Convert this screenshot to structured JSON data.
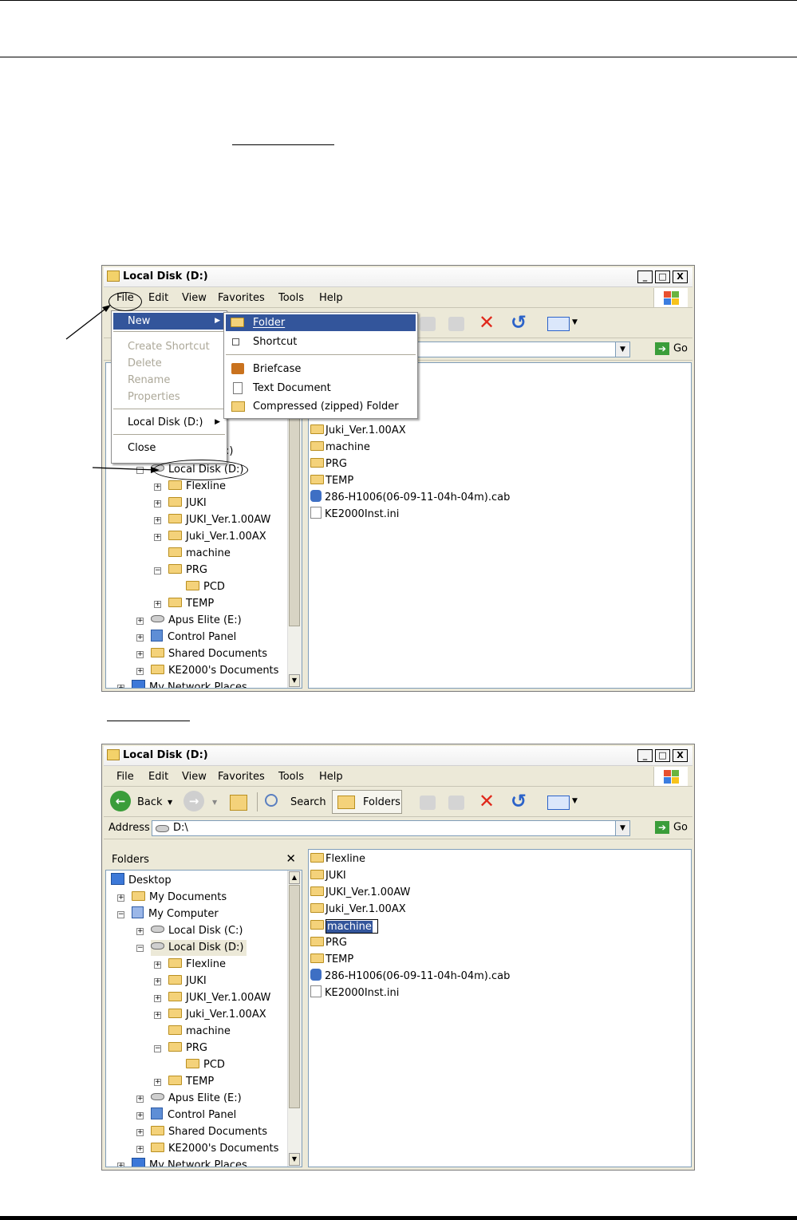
{
  "window1": {
    "title": "Local Disk (D:)",
    "menu": [
      "File",
      "Edit",
      "View",
      "Favorites",
      "Tools",
      "Help"
    ],
    "controls": [
      "_",
      "□",
      "X"
    ],
    "go_label": "Go",
    "file_menu": {
      "new": "New",
      "create_shortcut": "Create Shortcut",
      "delete": "Delete",
      "rename": "Rename",
      "properties": "Properties",
      "local_disk": "Local Disk (D:)",
      "close": "Close"
    },
    "new_submenu": {
      "folder": "Folder",
      "shortcut": "Shortcut",
      "briefcase": "Briefcase",
      "text_document": "Text Document",
      "compressed_folder": "Compressed (zipped) Folder"
    },
    "tree": {
      "partial_c": ":)",
      "local_d": "Local Disk (D:)",
      "flexline": "Flexline",
      "juki": "JUKI",
      "juki_aw": "JUKI_Ver.1.00AW",
      "juki_ax": "Juki_Ver.1.00AX",
      "machine": "machine",
      "prg": "PRG",
      "pcd": "PCD",
      "temp": "TEMP",
      "apus": "Apus Elite (E:)",
      "control_panel": "Control Panel",
      "shared_docs": "Shared Documents",
      "ke2000_docs": "KE2000's Documents",
      "network": "My Network Places"
    },
    "files": {
      "juki_ax": "Juki_Ver.1.00AX",
      "machine": "machine",
      "prg": "PRG",
      "temp": "TEMP",
      "cab": "286-H1006(06-09-11-04h-04m).cab",
      "ini": "KE2000Inst.ini"
    }
  },
  "window2": {
    "title": "Local Disk (D:)",
    "menu": [
      "File",
      "Edit",
      "View",
      "Favorites",
      "Tools",
      "Help"
    ],
    "controls": [
      "_",
      "□",
      "X"
    ],
    "toolbar": {
      "back": "Back",
      "search": "Search",
      "folders": "Folders"
    },
    "address_label": "Address",
    "address_value": "D:\\",
    "go_label": "Go",
    "folders_pane_title": "Folders",
    "tree": {
      "desktop": "Desktop",
      "my_documents": "My Documents",
      "my_computer": "My Computer",
      "local_c": "Local Disk (C:)",
      "local_d": "Local Disk (D:)",
      "flexline": "Flexline",
      "juki": "JUKI",
      "juki_aw": "JUKI_Ver.1.00AW",
      "juki_ax": "Juki_Ver.1.00AX",
      "machine": "machine",
      "prg": "PRG",
      "pcd": "PCD",
      "temp": "TEMP",
      "apus": "Apus Elite (E:)",
      "control_panel": "Control Panel",
      "shared_docs": "Shared Documents",
      "ke2000_docs": "KE2000's Documents",
      "network": "My Network Places"
    },
    "files": {
      "flexline": "Flexline",
      "juki": "JUKI",
      "juki_aw": "JUKI_Ver.1.00AW",
      "juki_ax": "Juki_Ver.1.00AX",
      "machine": "machine",
      "prg": "PRG",
      "temp": "TEMP",
      "cab": "286-H1006(06-09-11-04h-04m).cab",
      "ini": "KE2000Inst.ini"
    }
  }
}
